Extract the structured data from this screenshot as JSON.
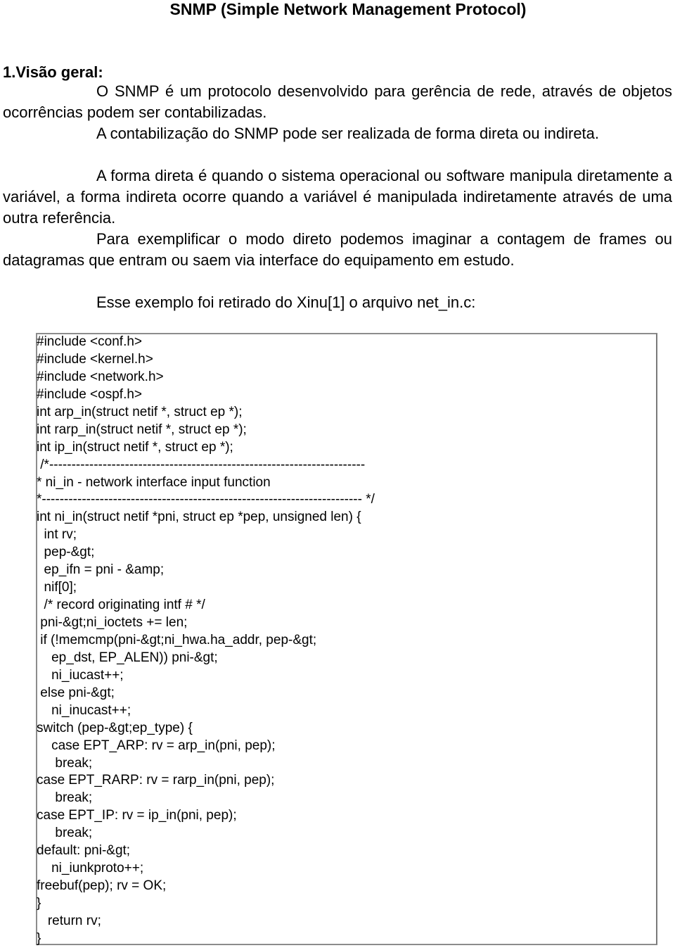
{
  "document": {
    "title": "SNMP (Simple Network Management Protocol)",
    "section_heading": "1.Visão geral:",
    "paragraphs": [
      "O SNMP  é um protocolo desenvolvido para gerência de rede, através de objetos ocorrências podem ser contabilizadas.",
      "A contabilização do SNMP pode ser realizada de forma direta ou indireta.",
      "A forma direta é quando o sistema operacional ou software manipula diretamente a variável, a forma indireta ocorre quando a variável é manipulada indiretamente através de uma outra referência.",
      "Para exemplificar o modo direto podemos imaginar a contagem de frames ou datagramas que entram ou saem via interface do equipamento em estudo.",
      "Esse exemplo foi retirado do Xinu[1] o arquivo net_in.c:"
    ],
    "code_lines": [
      "#include <conf.h>",
      "#include <kernel.h>",
      "#include <network.h>",
      "#include <ospf.h>",
      "int arp_in(struct netif *, struct ep *);",
      "int rarp_in(struct netif *, struct ep *);",
      "int ip_in(struct netif *, struct ep *);",
      " /*-----------------------------------------------------------------------",
      "* ni_in - network interface input function",
      "*------------------------------------------------------------------------ */",
      "int ni_in(struct netif *pni, struct ep *pep, unsigned len) {",
      "  int rv;",
      "  pep-&gt;",
      "  ep_ifn = pni - &amp;",
      "  nif[0];",
      "  /* record originating intf # */",
      " pni-&gt;ni_ioctets += len;",
      " if (!memcmp(pni-&gt;ni_hwa.ha_addr, pep-&gt;",
      "    ep_dst, EP_ALEN)) pni-&gt;",
      "    ni_iucast++;",
      " else pni-&gt;",
      "    ni_inucast++;",
      "switch (pep-&gt;ep_type) {",
      "    case EPT_ARP: rv = arp_in(pni, pep);",
      "     break;",
      "case EPT_RARP: rv = rarp_in(pni, pep);",
      "     break;",
      "case EPT_IP: rv = ip_in(pni, pep);",
      "     break;",
      "default: pni-&gt;",
      "    ni_iunkproto++;",
      "freebuf(pep); rv = OK;",
      "}",
      "   return rv;",
      "}"
    ]
  }
}
